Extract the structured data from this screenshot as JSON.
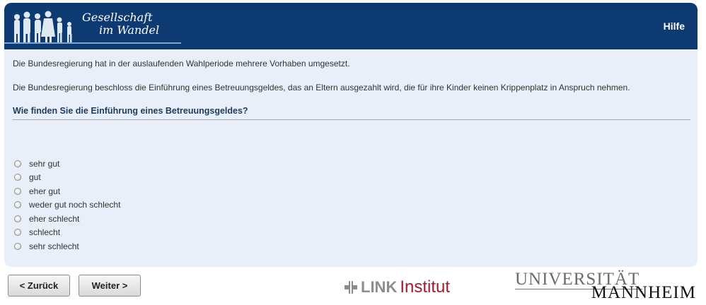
{
  "header": {
    "logo_line1": "Gesellschaft",
    "logo_line2": "im Wandel",
    "help_label": "Hilfe",
    "bg_color": "#0d3a70"
  },
  "content": {
    "intro": "Die Bundesregierung hat in der auslaufenden Wahlperiode mehrere Vorhaben umgesetzt.",
    "statement": "Die Bundesregierung beschloss die Einführung eines Betreuungsgeldes, das an Eltern ausgezahlt wird, die für ihre Kinder keinen Krippenplatz in Anspruch nehmen.",
    "question": "Wie finden Sie die Einführung eines Betreuungsgeldes?",
    "options": [
      "sehr gut",
      "gut",
      "eher gut",
      "weder gut noch schlecht",
      "eher schlecht",
      "schlecht",
      "sehr schlecht"
    ]
  },
  "nav": {
    "back_label": "< Zurück",
    "next_label": "Weiter >"
  },
  "footer": {
    "link_word": "LINK",
    "link_institut": "Institut",
    "uni_line1": "UNIVERSITÄT",
    "uni_line2": "MANNHEIM"
  }
}
